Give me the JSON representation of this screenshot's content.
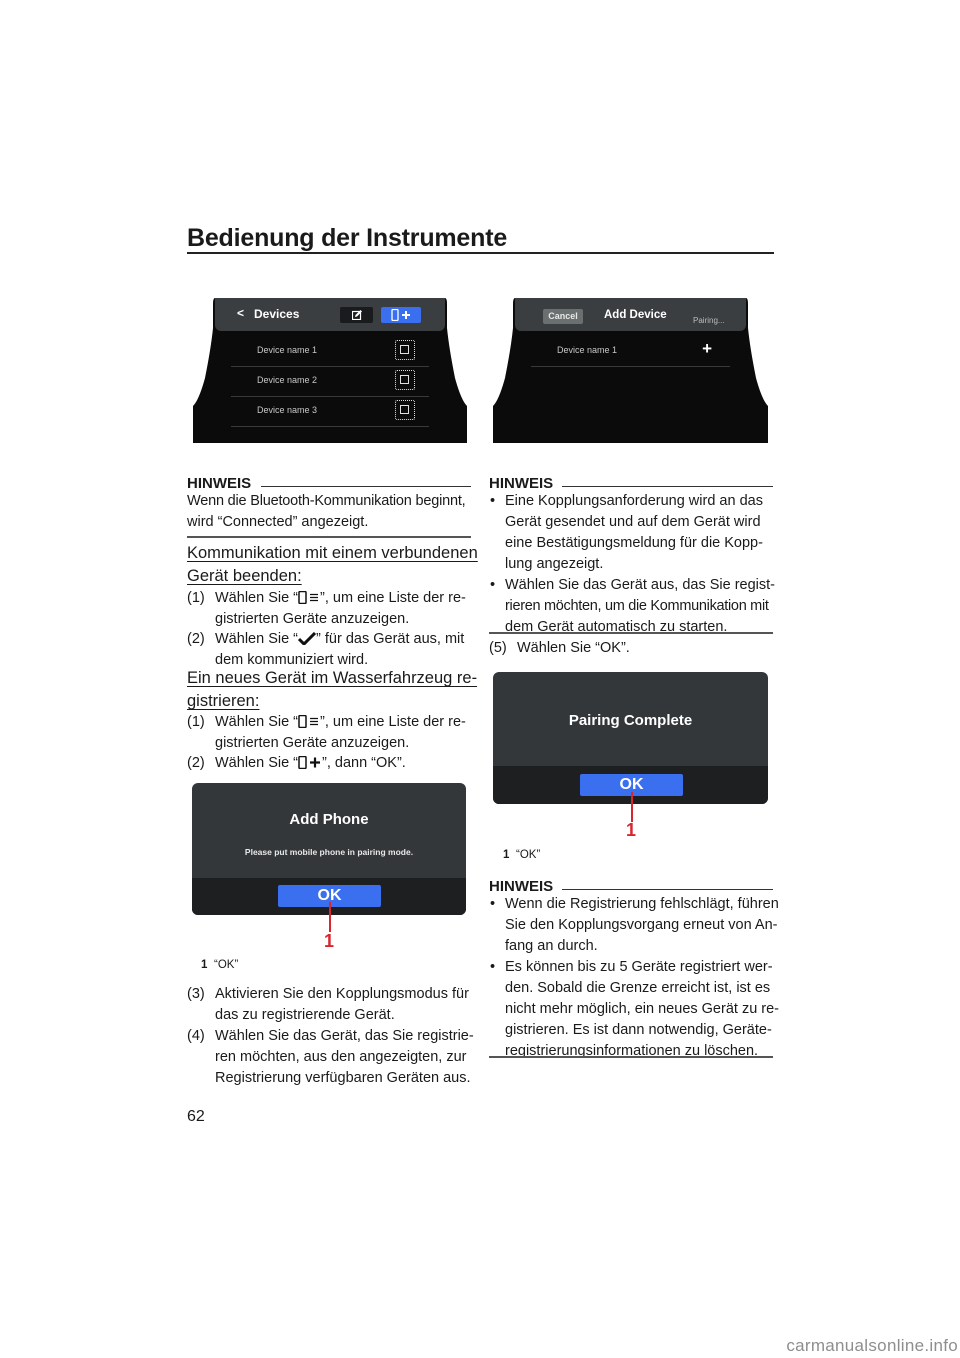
{
  "page": {
    "title": "Bedienung der Instrumente",
    "page_number": "62",
    "watermark": "carmanualsonline.info"
  },
  "devices_screen": {
    "back_label": "<",
    "title": "Devices",
    "edit_icon": "edit-icon",
    "add_icon": "phone-add-icon",
    "add_label": "+",
    "devices": [
      {
        "name": "Device name 1",
        "icon": "device-connect-icon"
      },
      {
        "name": "Device name 2",
        "icon": "device-connect-icon"
      },
      {
        "name": "Device name 3",
        "icon": "device-connect-icon"
      }
    ]
  },
  "add_device_screen": {
    "cancel_label": "Cancel",
    "title": "Add Device",
    "status": "Pairing...",
    "devices": [
      {
        "name": "Device name 1",
        "action": "+"
      }
    ]
  },
  "left_column": {
    "hinweis1": {
      "heading": "HINWEIS",
      "text_lines": [
        "Wenn die Bluetooth-Kommunikation beginnt,",
        "wird “Connected” angezeigt."
      ]
    },
    "section1": {
      "heading_lines": [
        "Kommunikation mit einem verbundenen",
        "Gerät beenden:"
      ],
      "steps": [
        {
          "num": "(1)",
          "pre": "Wählen Sie “",
          "icon": "phone-list-icon",
          "post": "”, um eine Liste der re-",
          "cont": "gistrierten Geräte anzuzeigen."
        },
        {
          "num": "(2)",
          "pre": "Wählen Sie “",
          "icon": "checkmark-icon",
          "post": "” für das Gerät aus, mit",
          "cont": "dem kommuniziert wird."
        }
      ]
    },
    "section2": {
      "heading_lines": [
        "Ein neues Gerät im Wasserfahrzeug re-",
        "gistrieren:"
      ],
      "steps": [
        {
          "num": "(1)",
          "pre": "Wählen Sie “",
          "icon": "phone-list-icon",
          "post": "”, um eine Liste der re-",
          "cont": "gistrierten Geräte anzuzeigen."
        },
        {
          "num": "(2)",
          "pre": "Wählen Sie “",
          "icon": "phone-add-icon",
          "post": "”, dann “OK”.",
          "cont": ""
        }
      ]
    },
    "add_phone_dialog": {
      "title": "Add Phone",
      "message": "Please put mobile phone in pairing mode.",
      "ok_label": "OK",
      "callout": "1"
    },
    "caption": {
      "num": "1",
      "text": "“OK”"
    },
    "steps_after": [
      {
        "num": "(3)",
        "lines": [
          "Aktivieren Sie den Kopplungsmodus für",
          "das zu registrierende Gerät."
        ]
      },
      {
        "num": "(4)",
        "lines": [
          "Wählen Sie das Gerät, das Sie registrie-",
          "ren möchten, aus den angezeigten, zur",
          "Registrierung verfügbaren Geräten aus."
        ]
      }
    ]
  },
  "right_column": {
    "hinweis2": {
      "heading": "HINWEIS",
      "bullets": [
        {
          "lines": [
            "Eine Kopplungsanforderung wird an das",
            "Gerät gesendet und auf dem Gerät wird",
            "eine Bestätigungsmeldung für die Kopp-",
            "lung angezeigt."
          ]
        },
        {
          "lines": [
            "Wählen Sie das Gerät aus, das Sie regist-",
            "rieren möchten, um die Kommunikation mit",
            "dem Gerät automatisch zu starten."
          ]
        }
      ]
    },
    "step5": {
      "num": "(5)",
      "text": "Wählen Sie “OK”."
    },
    "pairing_dialog": {
      "title": "Pairing Complete",
      "ok_label": "OK",
      "callout": "1"
    },
    "caption": {
      "num": "1",
      "text": "“OK”"
    },
    "hinweis3": {
      "heading": "HINWEIS",
      "bullets": [
        {
          "lines": [
            "Wenn die Registrierung fehlschlägt, führen",
            "Sie den Kopplungsvorgang erneut von An-",
            "fang an durch."
          ]
        },
        {
          "lines": [
            "Es können bis zu 5 Geräte registriert wer-",
            "den. Sobald die Grenze erreicht ist, ist es",
            "nicht mehr möglich, ein neues Gerät zu re-",
            "gistrieren. Es ist dann notwendig, Geräte-",
            "registrierungsinformationen zu löschen."
          ]
        }
      ]
    }
  }
}
